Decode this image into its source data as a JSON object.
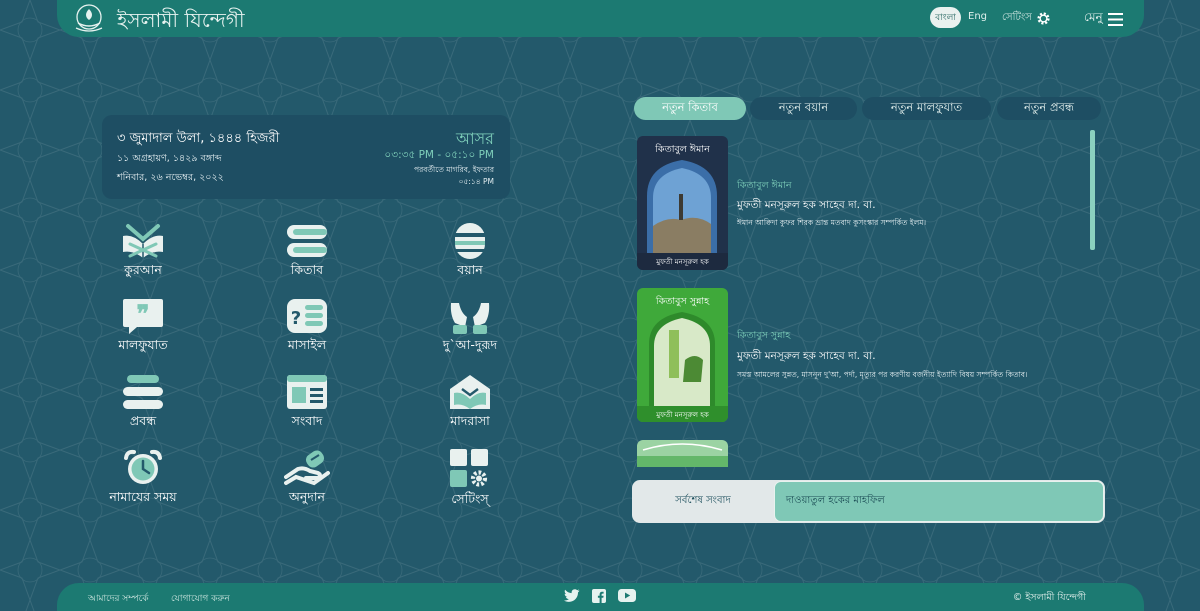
{
  "header": {
    "site_title": "ইসলামী যিন্দেগী",
    "lang_bangla": "বাংলা",
    "lang_english": "Eng",
    "settings_label": "সেটিংস",
    "menu_label": "মেনু"
  },
  "date_card": {
    "hijri": "৩ জুমাদাল উলা, ১৪৪৪ হিজরী",
    "bangla": "১১ অগ্রহায়ণ, ১৪২৯ বঙ্গাব্দ",
    "gregorian": "শনিবার, ২৬ নভেম্বর, ২০২২",
    "prayer_name": "আসর",
    "prayer_time": "০৩:৩৫ PM - ০৫:১০ PM",
    "next_prayer": "পরবর্তীতে মাগরিব, ইফতার",
    "next_time": "০৫:১৪ PM"
  },
  "grid": [
    {
      "label": "কুরআন",
      "icon": "quran-icon"
    },
    {
      "label": "কিতাব",
      "icon": "books-icon"
    },
    {
      "label": "বয়ান",
      "icon": "microphone-icon"
    },
    {
      "label": "মালফুযাত",
      "icon": "quote-icon"
    },
    {
      "label": "মাসাইল",
      "icon": "question-icon"
    },
    {
      "label": "দু`আ-দুরূদ",
      "icon": "praying-hands-icon"
    },
    {
      "label": "প্রবন্ধ",
      "icon": "article-icon"
    },
    {
      "label": "সংবাদ",
      "icon": "newspaper-icon"
    },
    {
      "label": "মাদরাসা",
      "icon": "madrasa-icon"
    },
    {
      "label": "নামাযের সময়",
      "icon": "alarm-clock-icon"
    },
    {
      "label": "অনুদান",
      "icon": "donation-icon"
    },
    {
      "label": "সেটিংস্",
      "icon": "settings-grid-icon"
    }
  ],
  "tabs": [
    "নতুন কিতাব",
    "নতুন বয়ান",
    "নতুন মালফুযাত",
    "নতুন প্রবন্ধ"
  ],
  "books": [
    {
      "cover_title": "কিতাবুল ঈমান",
      "cover_author": "মুফতী মনসূরুল হক",
      "name": "কিতাবুল ঈমান",
      "author": "মুফতী মনসূরুল হক সাহেব দা. বা.",
      "desc": "ঈমান আক্বিদা কুফর শিরক ভ্রান্ত মতবাদ কুসংস্কার সম্পর্কিত ইলম।"
    },
    {
      "cover_title": "কিতাবুস সুন্নাহ",
      "cover_author": "মুফতী মনসূরুল হক",
      "name": "কিতাবুস সুন্নাহ",
      "author": "মুফতী মনসূরুল হক সাহেব দা. বা.",
      "desc": "সমস্ত আমলের সুন্নত, মাসনূন দু'আ, পর্দা, মৃত্যুর পর করণীয় বর্জনীয় ইত্যাদি বিষয় সম্পর্কিত কিতাব।"
    }
  ],
  "news": {
    "label": "সর্বশেষ সংবাদ",
    "text": "দাওয়াতুল হকের মাহফিল"
  },
  "footer": {
    "about": "আমাদের সম্পর্কে",
    "contact": "যোগাযোগ করুন",
    "copyright": "© ইসলামী যিন্দেগী"
  },
  "colors": {
    "background": "#23596b",
    "header": "#1c7a72",
    "accent": "#7fc8b6",
    "card": "#1e4e63"
  }
}
